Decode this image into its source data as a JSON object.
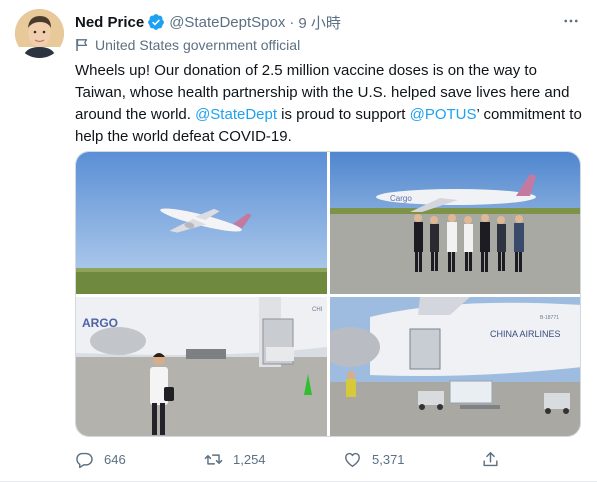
{
  "author": {
    "name": "Ned Price",
    "handle": "@StateDeptSpox",
    "separator": "·",
    "time": "9 小時",
    "label": "United States government official",
    "verified": true
  },
  "tweet": {
    "text_1": "Wheels up! Our donation of 2.5 million vaccine doses is on the way to Taiwan, whose health partnership with the U.S. helped save lives here and around the world. ",
    "mention_1": "@StateDept",
    "text_2": " is proud to support ",
    "mention_2": "@POTUS",
    "text_3": "’ commitment to help the world defeat COVID-19."
  },
  "media": {
    "photo_count": 4,
    "photo_2_text": "Cargo",
    "photo_3_text": "ARGO",
    "photo_3_small_text": "CHI",
    "photo_4_text": "CHINA AIRLINES",
    "photo_4_small_text": "B-18771"
  },
  "actions": {
    "replies": "646",
    "retweets": "1,254",
    "likes": "5,371"
  },
  "colors": {
    "accent": "#1da1f2",
    "secondary_text": "#5b7083",
    "primary_text": "#0f1419"
  },
  "icons": [
    "verified-badge-icon",
    "more-icon",
    "government-flag-icon",
    "reply-icon",
    "retweet-icon",
    "like-icon",
    "share-icon"
  ]
}
